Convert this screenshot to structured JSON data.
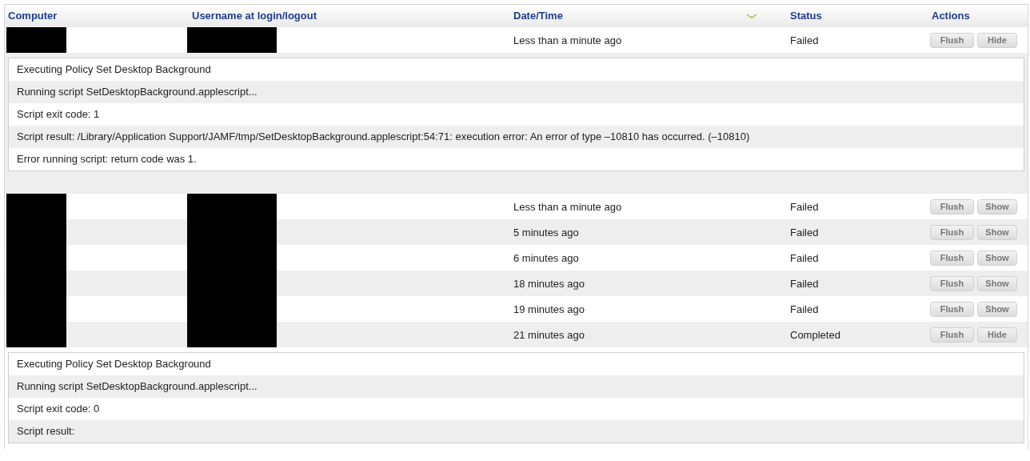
{
  "table": {
    "columns": [
      {
        "label": "Computer",
        "sorted": false
      },
      {
        "label": "Username at login/logout",
        "sorted": false
      },
      {
        "label": "Date/Time",
        "sorted": true
      },
      {
        "label": "Status",
        "sorted": false
      },
      {
        "label": "Actions",
        "sorted": false
      }
    ],
    "items": [
      {
        "kind": "row",
        "redacted": true,
        "date": "Less than a minute ago",
        "status": "Failed",
        "buttons": [
          "Flush",
          "Hide"
        ]
      },
      {
        "kind": "log",
        "lines": [
          "Executing Policy Set Desktop Background",
          "Running script SetDesktopBackground.applescript...",
          "Script exit code: 1",
          "Script result: /Library/Application Support/JAMF/tmp/SetDesktopBackground.applescript:54:71: execution error: An error of type –10810 has occurred. (–10810)",
          "Error running script: return code was 1."
        ]
      },
      {
        "kind": "spacer"
      },
      {
        "kind": "row",
        "redacted": true,
        "date": "Less than a minute ago",
        "status": "Failed",
        "buttons": [
          "Flush",
          "Show"
        ]
      },
      {
        "kind": "row",
        "redacted": true,
        "date": "5 minutes ago",
        "status": "Failed",
        "buttons": [
          "Flush",
          "Show"
        ]
      },
      {
        "kind": "row",
        "redacted": true,
        "date": "6 minutes ago",
        "status": "Failed",
        "buttons": [
          "Flush",
          "Show"
        ]
      },
      {
        "kind": "row",
        "redacted": true,
        "date": "18 minutes ago",
        "status": "Failed",
        "buttons": [
          "Flush",
          "Show"
        ]
      },
      {
        "kind": "row",
        "redacted": true,
        "date": "19 minutes ago",
        "status": "Failed",
        "buttons": [
          "Flush",
          "Show"
        ]
      },
      {
        "kind": "row",
        "redacted": true,
        "date": "21 minutes ago",
        "status": "Completed",
        "buttons": [
          "Flush",
          "Hide"
        ]
      },
      {
        "kind": "log",
        "lines": [
          "Executing Policy Set Desktop Background",
          "Running script SetDesktopBackground.applescript...",
          "Script exit code: 0",
          "Script result:"
        ]
      }
    ]
  }
}
